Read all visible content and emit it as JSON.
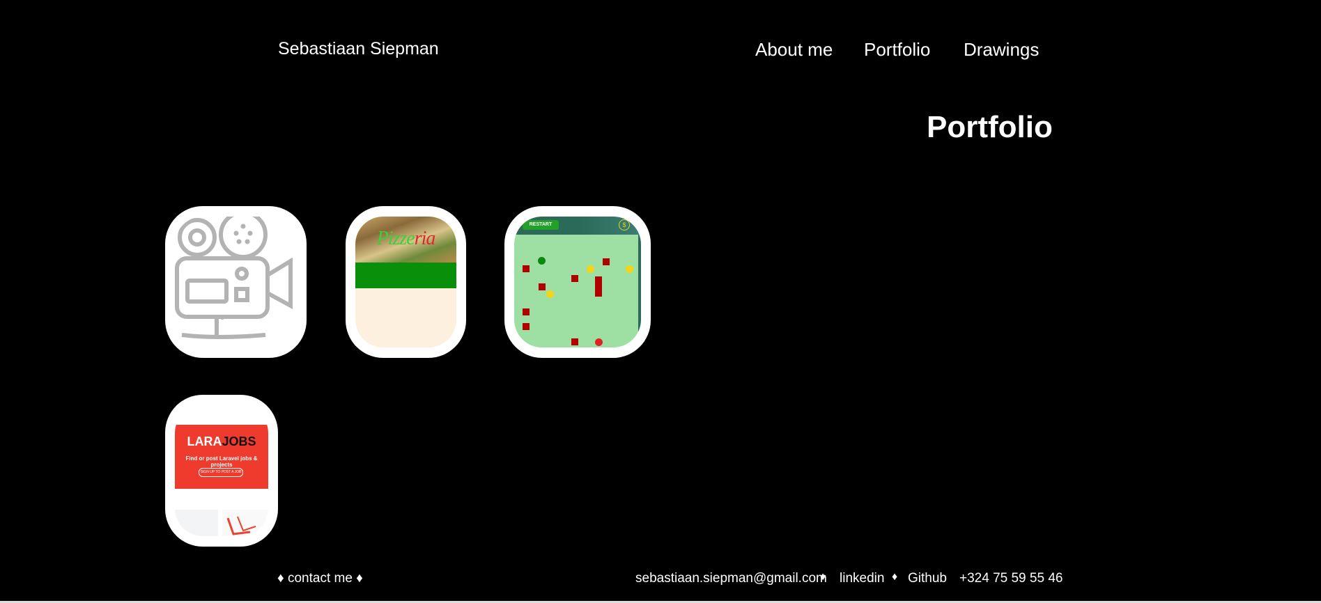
{
  "header": {
    "site_name": "Sebastiaan Siepman",
    "nav": {
      "about": "About me",
      "portfolio": "Portfolio",
      "drawings": "Drawings"
    }
  },
  "main": {
    "title": "Portfolio",
    "projects": [
      {
        "thumbnail": "movie-camera-icon"
      },
      {
        "thumbnail": "pizzeria-site",
        "title_part1": "Pizze",
        "title_part2": "ria"
      },
      {
        "thumbnail": "game-board",
        "restart_label": "RESTART",
        "coin_symbol": "$"
      },
      {
        "thumbnail": "larajobs-site",
        "logo_part1": "LARA",
        "logo_part2": "JOBS",
        "tagline": "Find or post Laravel jobs & projects",
        "button": "SIGN UP TO POST A JOB"
      }
    ]
  },
  "footer": {
    "contact_label": "♦ contact me ♦",
    "email": "sebastiaan.siepman@gmail.com",
    "separator": "♦",
    "linkedin": "linkedin",
    "github": "Github",
    "phone": "+324 75 59 55 46"
  },
  "colors": {
    "background": "#000000",
    "text": "#ffffff",
    "card": "#ffffff",
    "pizzeria_green": "#0a8f0a",
    "larajobs_red": "#ef3b2d"
  }
}
